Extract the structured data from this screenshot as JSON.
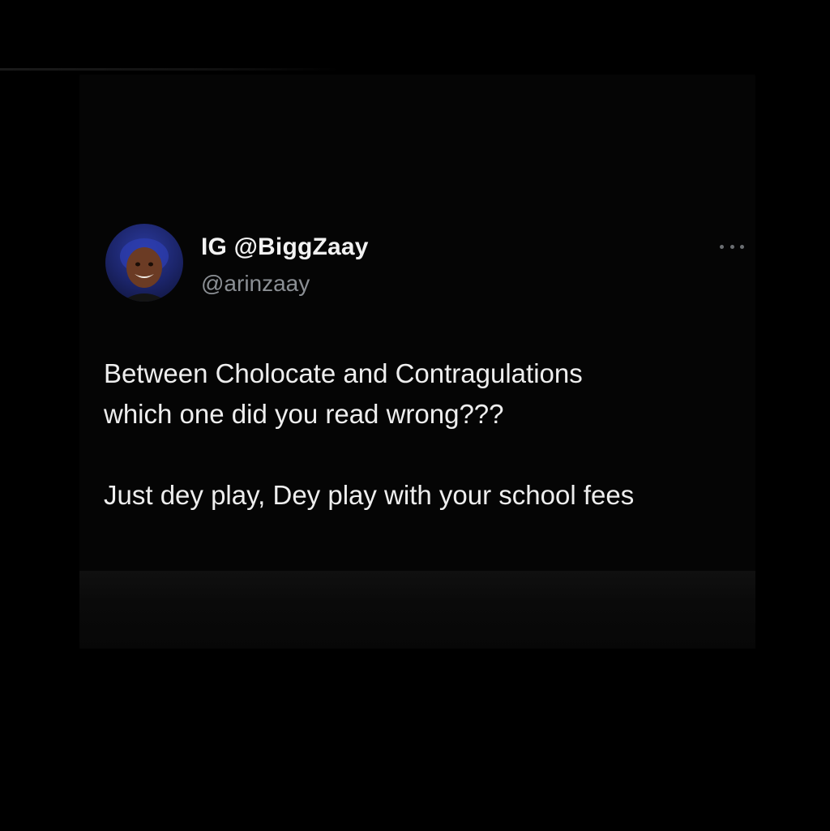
{
  "tweet": {
    "display_name": "IG @BiggZaay",
    "handle": "@arinzaay",
    "avatar_icon": "user-avatar",
    "more_icon": "ellipsis-icon",
    "paragraphs": [
      {
        "lines": [
          "Between Cholocate and Contragulations",
          "which one did you read wrong???"
        ]
      },
      {
        "lines": [
          "Just dey play, Dey play with your school fees"
        ]
      }
    ]
  },
  "colors": {
    "background": "#000000",
    "card": "#050505",
    "primary_text": "#eeeeee",
    "secondary_text": "#8b8f94",
    "avatar_blue": "#1b2468"
  }
}
